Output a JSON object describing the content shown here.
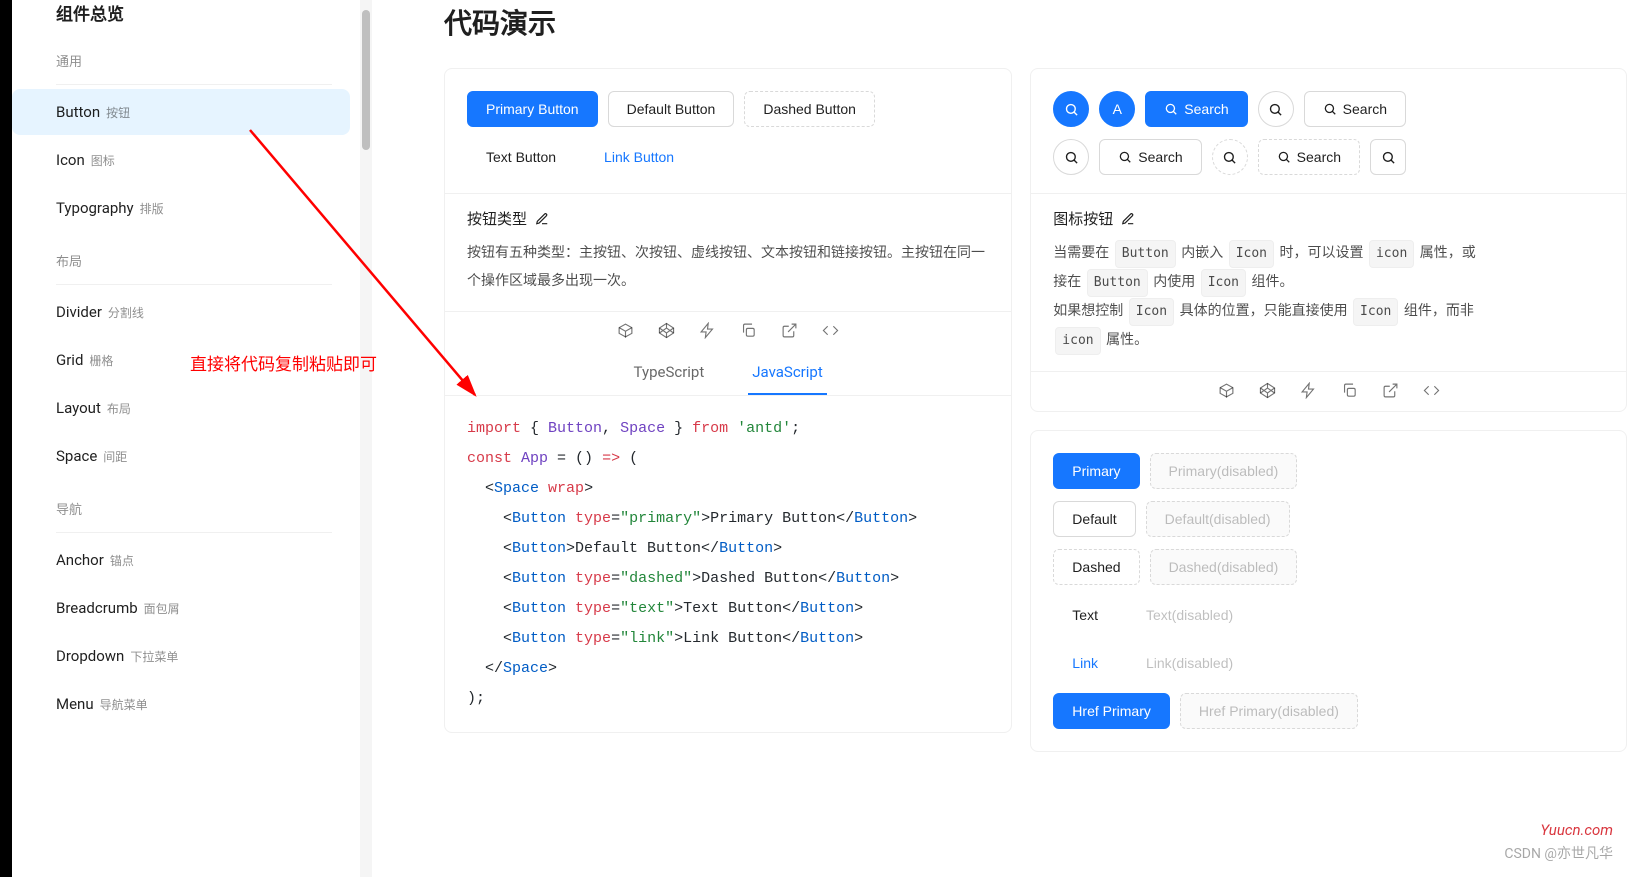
{
  "sidebar": {
    "heading": "组件总览",
    "groups": [
      {
        "label": "通用",
        "items": [
          {
            "en": "Button",
            "zh": "按钮",
            "active": true
          },
          {
            "en": "Icon",
            "zh": "图标"
          },
          {
            "en": "Typography",
            "zh": "排版"
          }
        ]
      },
      {
        "label": "布局",
        "items": [
          {
            "en": "Divider",
            "zh": "分割线"
          },
          {
            "en": "Grid",
            "zh": "栅格"
          },
          {
            "en": "Layout",
            "zh": "布局"
          },
          {
            "en": "Space",
            "zh": "间距"
          }
        ]
      },
      {
        "label": "导航",
        "items": [
          {
            "en": "Anchor",
            "zh": "锚点"
          },
          {
            "en": "Breadcrumb",
            "zh": "面包屑"
          },
          {
            "en": "Dropdown",
            "zh": "下拉菜单"
          },
          {
            "en": "Menu",
            "zh": "导航菜单"
          }
        ]
      }
    ]
  },
  "title": "代码演示",
  "annotation": "直接将代码复制粘贴即可",
  "leftCard": {
    "buttons": {
      "primary": "Primary Button",
      "default": "Default Button",
      "dashed": "Dashed Button",
      "text": "Text Button",
      "link": "Link Button"
    },
    "metaTitle": "按钮类型",
    "metaDesc": "按钮有五种类型：主按钮、次按钮、虚线按钮、文本按钮和链接按钮。主按钮在同一个操作区域最多出现一次。",
    "tabs": {
      "ts": "TypeScript",
      "js": "JavaScript"
    },
    "codeTokens": [
      [
        [
          "kw",
          "import"
        ],
        [
          "plain",
          " { "
        ],
        [
          "fn",
          "Button"
        ],
        [
          "punc",
          ", "
        ],
        [
          "fn",
          "Space"
        ],
        [
          "plain",
          " } "
        ],
        [
          "kw",
          "from"
        ],
        [
          "plain",
          " "
        ],
        [
          "str",
          "'antd'"
        ],
        [
          "punc",
          ";"
        ]
      ],
      [
        [
          "kw",
          "const"
        ],
        [
          "plain",
          " "
        ],
        [
          "fn",
          "App"
        ],
        [
          "plain",
          " = () "
        ],
        [
          "kw",
          "=>"
        ],
        [
          "plain",
          " ("
        ]
      ],
      [
        [
          "plain",
          "  <"
        ],
        [
          "tag",
          "Space"
        ],
        [
          "plain",
          " "
        ],
        [
          "attr",
          "wrap"
        ],
        [
          "plain",
          ">"
        ]
      ],
      [
        [
          "plain",
          "    <"
        ],
        [
          "tag",
          "Button"
        ],
        [
          "plain",
          " "
        ],
        [
          "attr",
          "type"
        ],
        [
          "punc",
          "="
        ],
        [
          "str",
          "\"primary\""
        ],
        [
          "plain",
          ">Primary Button</"
        ],
        [
          "tag",
          "Button"
        ],
        [
          "plain",
          ">"
        ]
      ],
      [
        [
          "plain",
          "    <"
        ],
        [
          "tag",
          "Button"
        ],
        [
          "plain",
          ">Default Button</"
        ],
        [
          "tag",
          "Button"
        ],
        [
          "plain",
          ">"
        ]
      ],
      [
        [
          "plain",
          "    <"
        ],
        [
          "tag",
          "Button"
        ],
        [
          "plain",
          " "
        ],
        [
          "attr",
          "type"
        ],
        [
          "punc",
          "="
        ],
        [
          "str",
          "\"dashed\""
        ],
        [
          "plain",
          ">Dashed Button</"
        ],
        [
          "tag",
          "Button"
        ],
        [
          "plain",
          ">"
        ]
      ],
      [
        [
          "plain",
          "    <"
        ],
        [
          "tag",
          "Button"
        ],
        [
          "plain",
          " "
        ],
        [
          "attr",
          "type"
        ],
        [
          "punc",
          "="
        ],
        [
          "str",
          "\"text\""
        ],
        [
          "plain",
          ">Text Button</"
        ],
        [
          "tag",
          "Button"
        ],
        [
          "plain",
          ">"
        ]
      ],
      [
        [
          "plain",
          "    <"
        ],
        [
          "tag",
          "Button"
        ],
        [
          "plain",
          " "
        ],
        [
          "attr",
          "type"
        ],
        [
          "punc",
          "="
        ],
        [
          "str",
          "\"link\""
        ],
        [
          "plain",
          ">Link Button</"
        ],
        [
          "tag",
          "Button"
        ],
        [
          "plain",
          ">"
        ]
      ],
      [
        [
          "plain",
          "  </"
        ],
        [
          "tag",
          "Space"
        ],
        [
          "plain",
          ">"
        ]
      ],
      [
        [
          "plain",
          ");"
        ]
      ]
    ]
  },
  "rightCard": {
    "searchLabel": "Search",
    "avatar": "A",
    "metaTitle": "图标按钮",
    "descTags": {
      "button": "Button",
      "icon": "Icon",
      "iconLower": "icon"
    },
    "descParts": {
      "p1a": "当需要在 ",
      "p1b": " 内嵌入 ",
      "p1c": " 时，可以设置 ",
      "p1d": " 属性，或",
      "p2a": "接在 ",
      "p2b": " 内使用 ",
      "p2c": " 组件。",
      "p3a": "如果想控制 ",
      "p3b": " 具体的位置，只能直接使用 ",
      "p3c": " 组件，而非",
      "p4b": " 属性。"
    },
    "disabledButtons": {
      "primary": "Primary",
      "primaryD": "Primary(disabled)",
      "default": "Default",
      "defaultD": "Default(disabled)",
      "dashed": "Dashed",
      "dashedD": "Dashed(disabled)",
      "text": "Text",
      "textD": "Text(disabled)",
      "link": "Link",
      "linkD": "Link(disabled)",
      "href": "Href Primary",
      "hrefD": "Href Primary(disabled)"
    }
  },
  "watermark1": "Yuucn.com",
  "watermark2": "CSDN @亦世凡华"
}
